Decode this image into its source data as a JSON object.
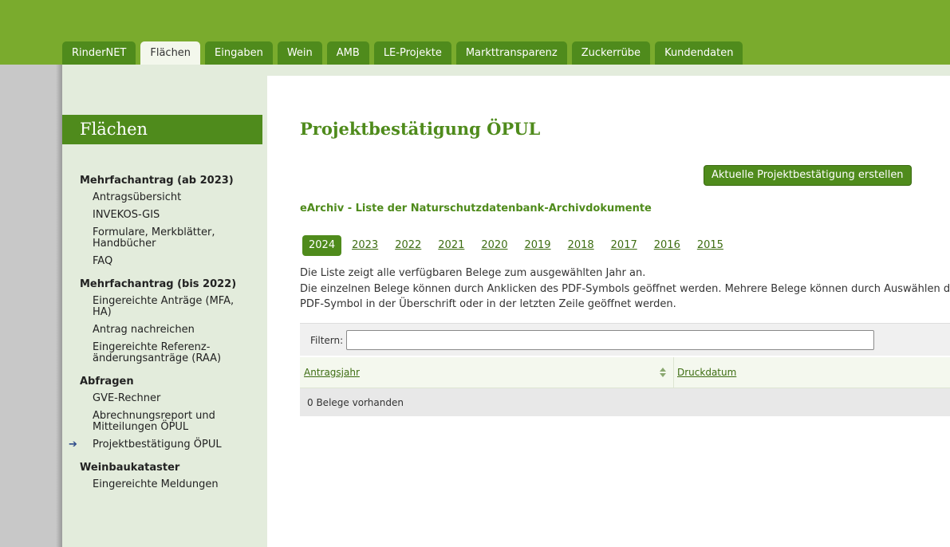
{
  "tabs": [
    "RinderNET",
    "Flächen",
    "Eingaben",
    "Wein",
    "AMB",
    "LE-Projekte",
    "Markttransparenz",
    "Zuckerrübe",
    "Kundendaten"
  ],
  "active_tab": "Flächen",
  "sidebar": {
    "title": "Flächen",
    "sections": [
      {
        "heading": "Mehrfachantrag (ab 2023)",
        "items": [
          "Antragsübersicht",
          "INVEKOS-GIS",
          "Formulare, Merkblätter, Handbücher",
          "FAQ"
        ]
      },
      {
        "heading": "Mehrfachantrag (bis 2022)",
        "items": [
          "Eingereichte Anträge (MFA, HA)",
          "Antrag nachreichen",
          "Eingereichte Referenz-änderungsanträge (RAA)"
        ]
      },
      {
        "heading": "Abfragen",
        "items": [
          "GVE-Rechner",
          "Abrechnungsreport und Mitteilungen ÖPUL",
          "Projektbestätigung ÖPUL"
        ]
      },
      {
        "heading": "Weinbaukataster",
        "items": [
          "Eingereichte Meldungen"
        ]
      }
    ],
    "current_item": "Projektbestätigung ÖPUL",
    "current_marker": "➔"
  },
  "main": {
    "title": "Projektbestätigung ÖPUL",
    "action_button": "Aktuelle Projektbestätigung erstellen",
    "subtitle": "eArchiv - Liste der Naturschutzdatenbank-Archivdokumente",
    "years": [
      "2024",
      "2023",
      "2022",
      "2021",
      "2020",
      "2019",
      "2018",
      "2017",
      "2016",
      "2015"
    ],
    "selected_year": "2024",
    "info_line1": "Die Liste zeigt alle verfügbaren Belege zum ausgewählten Jahr an.",
    "info_line2": "Die einzelnen Belege können durch Anklicken des PDF-Symbols geöffnet werden. Mehrere Belege können durch Auswählen d",
    "info_line3": "PDF-Symbol in der Überschrift oder in der letzten Zeile geöffnet werden.",
    "filter_label": "Filtern:",
    "filter_value": "",
    "columns": [
      "Antragsjahr",
      "Druckdatum"
    ],
    "empty_text": "0 Belege vorhanden"
  },
  "colors": {
    "header_green": "#7aab2d",
    "dark_green": "#4f8b1c",
    "sidebar_bg": "#e3ecdc",
    "link_green": "#3d6d12"
  }
}
